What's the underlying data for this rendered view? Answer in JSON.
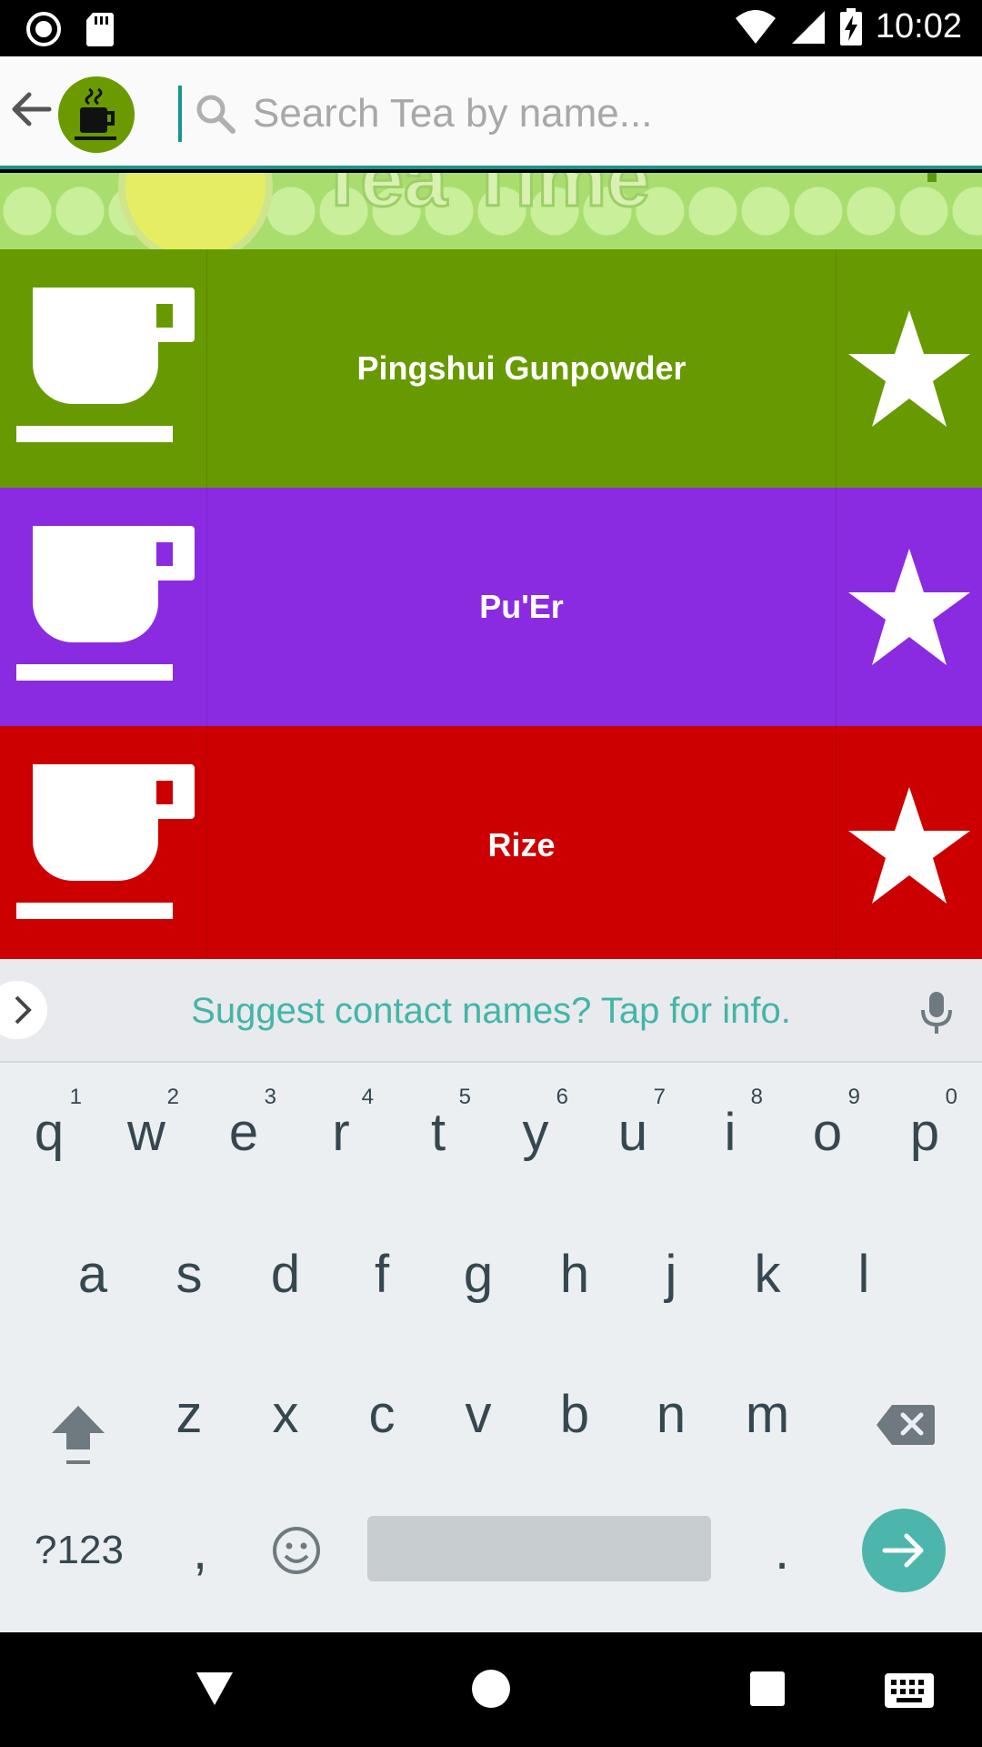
{
  "status_bar": {
    "time": "10:02"
  },
  "search": {
    "placeholder": "Search Tea by name..."
  },
  "banner": {
    "title": "Tea Time"
  },
  "teas": [
    {
      "name": "Pingshui Gunpowder",
      "color": "#679a00"
    },
    {
      "name": "Pu'Er",
      "color": "#8a2be2"
    },
    {
      "name": "Rize",
      "color": "#cc0000"
    }
  ],
  "keyboard": {
    "suggestion": "Suggest contact names? Tap for info.",
    "row1": [
      {
        "key": "q",
        "hint": "1"
      },
      {
        "key": "w",
        "hint": "2"
      },
      {
        "key": "e",
        "hint": "3"
      },
      {
        "key": "r",
        "hint": "4"
      },
      {
        "key": "t",
        "hint": "5"
      },
      {
        "key": "y",
        "hint": "6"
      },
      {
        "key": "u",
        "hint": "7"
      },
      {
        "key": "i",
        "hint": "8"
      },
      {
        "key": "o",
        "hint": "9"
      },
      {
        "key": "p",
        "hint": "0"
      }
    ],
    "row2": [
      "a",
      "s",
      "d",
      "f",
      "g",
      "h",
      "j",
      "k",
      "l"
    ],
    "row3": [
      "z",
      "x",
      "c",
      "v",
      "b",
      "n",
      "m"
    ],
    "symbols_label": "?123",
    "comma": ",",
    "period": "."
  },
  "colors": {
    "accent": "#17958d",
    "keyboard_text": "#37474f",
    "suggestion": "#43b5a8"
  }
}
